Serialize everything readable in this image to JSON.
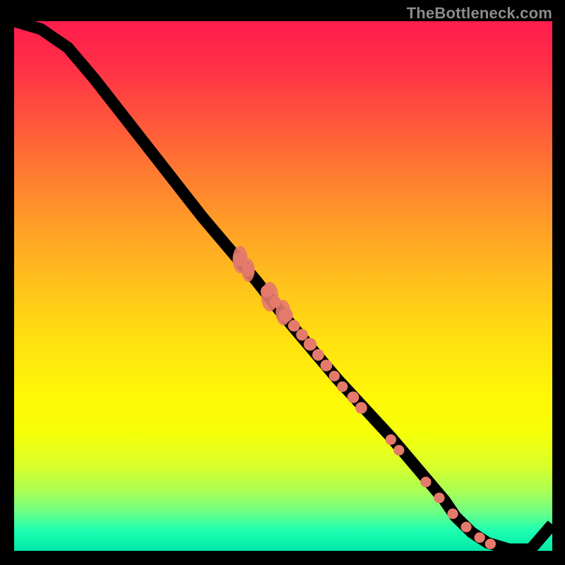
{
  "watermark": "TheBottleneck.com",
  "colors": {
    "dot": "#e47a6b",
    "curve": "#000000"
  },
  "chart_data": {
    "type": "line",
    "title": "",
    "xlabel": "",
    "ylabel": "",
    "xlim": [
      0,
      100
    ],
    "ylim": [
      0,
      100
    ],
    "grid": false,
    "series": [
      {
        "name": "curve",
        "x": [
          0,
          5,
          10,
          15,
          20,
          25,
          30,
          35,
          40,
          45,
          50,
          55,
          60,
          65,
          70,
          75,
          80,
          82,
          85,
          88,
          92,
          96,
          100
        ],
        "y": [
          100,
          98.5,
          95,
          89,
          82.5,
          76,
          69.5,
          63,
          57,
          51,
          44.5,
          38.5,
          32.5,
          27,
          21.5,
          15.5,
          9.5,
          6.5,
          3.5,
          1.5,
          0.3,
          0.3,
          5
        ]
      }
    ],
    "markers": {
      "name": "highlighted-points",
      "blobs": [
        {
          "x": 42,
          "y": 55,
          "rx": 1.4,
          "ry": 2.6
        },
        {
          "x": 43.5,
          "y": 53,
          "rx": 1.2,
          "ry": 2.2
        },
        {
          "x": 47.5,
          "y": 48,
          "rx": 1.6,
          "ry": 2.8
        },
        {
          "x": 50,
          "y": 45,
          "rx": 1.4,
          "ry": 2.4
        }
      ],
      "dots": [
        {
          "x": 42,
          "y": 55,
          "r": 1.3
        },
        {
          "x": 43.5,
          "y": 53,
          "r": 1.2
        },
        {
          "x": 47,
          "y": 49,
          "r": 1.2
        },
        {
          "x": 48.5,
          "y": 47,
          "r": 1.1
        },
        {
          "x": 50.5,
          "y": 44.5,
          "r": 1.3
        },
        {
          "x": 52,
          "y": 42.5,
          "r": 1.1
        },
        {
          "x": 53.5,
          "y": 40.8,
          "r": 1.1
        },
        {
          "x": 55,
          "y": 39,
          "r": 1.2
        },
        {
          "x": 56.5,
          "y": 37,
          "r": 1.1
        },
        {
          "x": 58,
          "y": 35,
          "r": 1.1
        },
        {
          "x": 59.5,
          "y": 33,
          "r": 1.0
        },
        {
          "x": 61,
          "y": 31,
          "r": 1.0
        },
        {
          "x": 63,
          "y": 29,
          "r": 1.1
        },
        {
          "x": 64.5,
          "y": 27,
          "r": 1.1
        },
        {
          "x": 70,
          "y": 21,
          "r": 1.0
        },
        {
          "x": 71.5,
          "y": 19,
          "r": 1.0
        },
        {
          "x": 76.5,
          "y": 13,
          "r": 1.0
        },
        {
          "x": 79,
          "y": 10,
          "r": 1.0
        },
        {
          "x": 81.5,
          "y": 7,
          "r": 1.0
        },
        {
          "x": 84,
          "y": 4.5,
          "r": 1.0
        },
        {
          "x": 86.5,
          "y": 2.5,
          "r": 1.0
        },
        {
          "x": 88.5,
          "y": 1.3,
          "r": 1.0
        }
      ]
    }
  }
}
